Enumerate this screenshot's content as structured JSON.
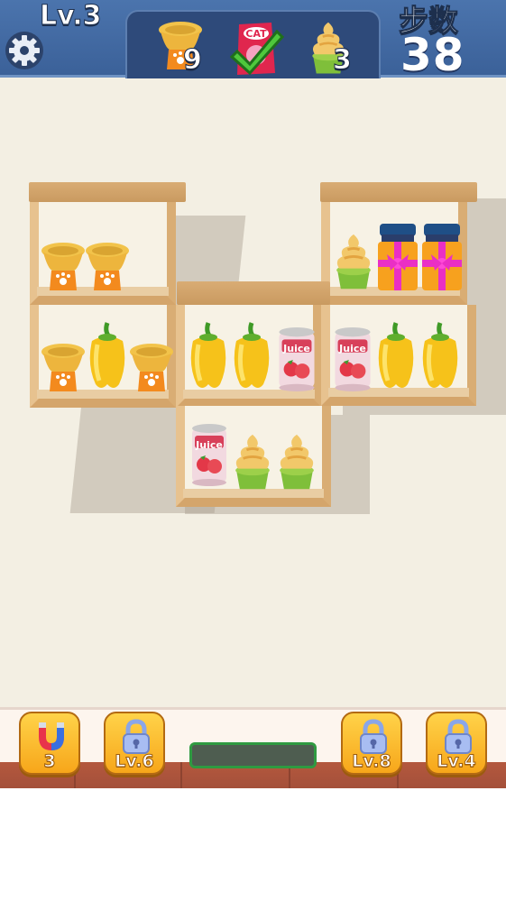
{
  "hud": {
    "level": "Lv.3",
    "steps_label": "步数",
    "steps_value": "38",
    "goals": [
      {
        "icon": "pet-bowl-icon",
        "count": "9"
      },
      {
        "icon": "cat-food-bag-icon",
        "completed": true
      },
      {
        "icon": "ice-cream-cone-icon",
        "count": "3"
      }
    ]
  },
  "shelves": {
    "row1_left": [
      "pet-bowl",
      "pet-bowl",
      "empty"
    ],
    "row1_right": [
      "ice-cream-cone",
      "gift-jar",
      "gift-jar"
    ],
    "row2_left": [
      "pet-bowl",
      "yellow-pepper",
      "pet-bowl"
    ],
    "row2_middle": [
      "yellow-pepper",
      "yellow-pepper",
      "juice-can"
    ],
    "row2_right": [
      "juice-can",
      "yellow-pepper",
      "yellow-pepper"
    ],
    "row3_middle": [
      "juice-can",
      "ice-cream-cone",
      "ice-cream-cone"
    ]
  },
  "items": {
    "juice_label": "Juice",
    "cat_label": "CAT"
  },
  "toolbar": {
    "magnet_count": "3",
    "lock1_label": "Lv.6",
    "lock2_label": "Lv.8",
    "lock3_label": "Lv.4"
  },
  "colors": {
    "hud_blue": "#3b6199",
    "wood": "#d4a56b",
    "tool_orange": "#f7a61a",
    "progress_green": "#2f9a41"
  }
}
